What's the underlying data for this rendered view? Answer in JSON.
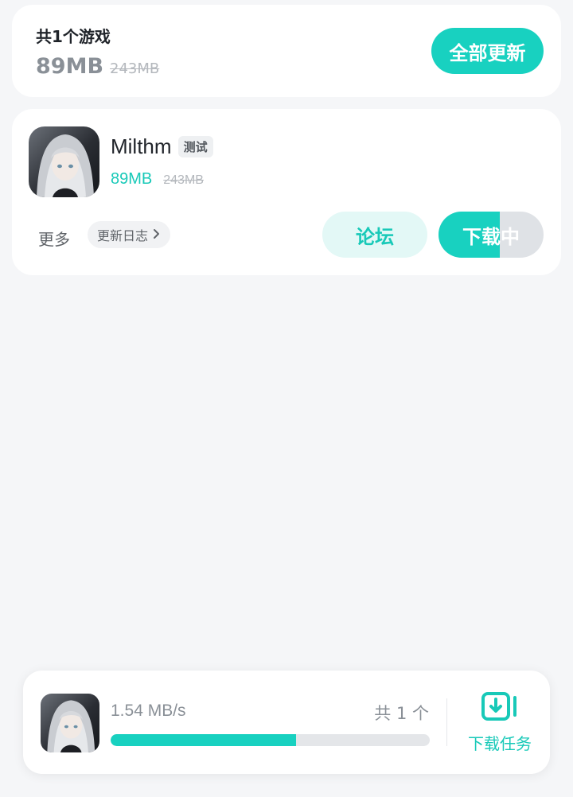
{
  "summary": {
    "title": "共1个游戏",
    "size_new": "89MB",
    "size_old": "243MB",
    "update_all_label": "全部更新"
  },
  "game": {
    "name": "Milthm",
    "tag": "测试",
    "size_new": "89MB",
    "size_old": "243MB",
    "more_label": "更多",
    "changelog_label": "更新日志",
    "forum_label": "论坛",
    "download_label": "下载中",
    "download_progress": 0.58
  },
  "download_bar": {
    "speed": "1.54 MB/s",
    "count": "共 1 个",
    "progress": 0.58,
    "tasks_label": "下载任务"
  },
  "colors": {
    "accent": "#18d1c0",
    "accent_text": "#18c9b8",
    "accent_light": "#e3f8f6",
    "background": "#f5f6f8"
  },
  "icons": {
    "game_icon": "anime-character-avatar",
    "chevron": "chevron-right-icon",
    "tasks": "download-tray-icon"
  }
}
